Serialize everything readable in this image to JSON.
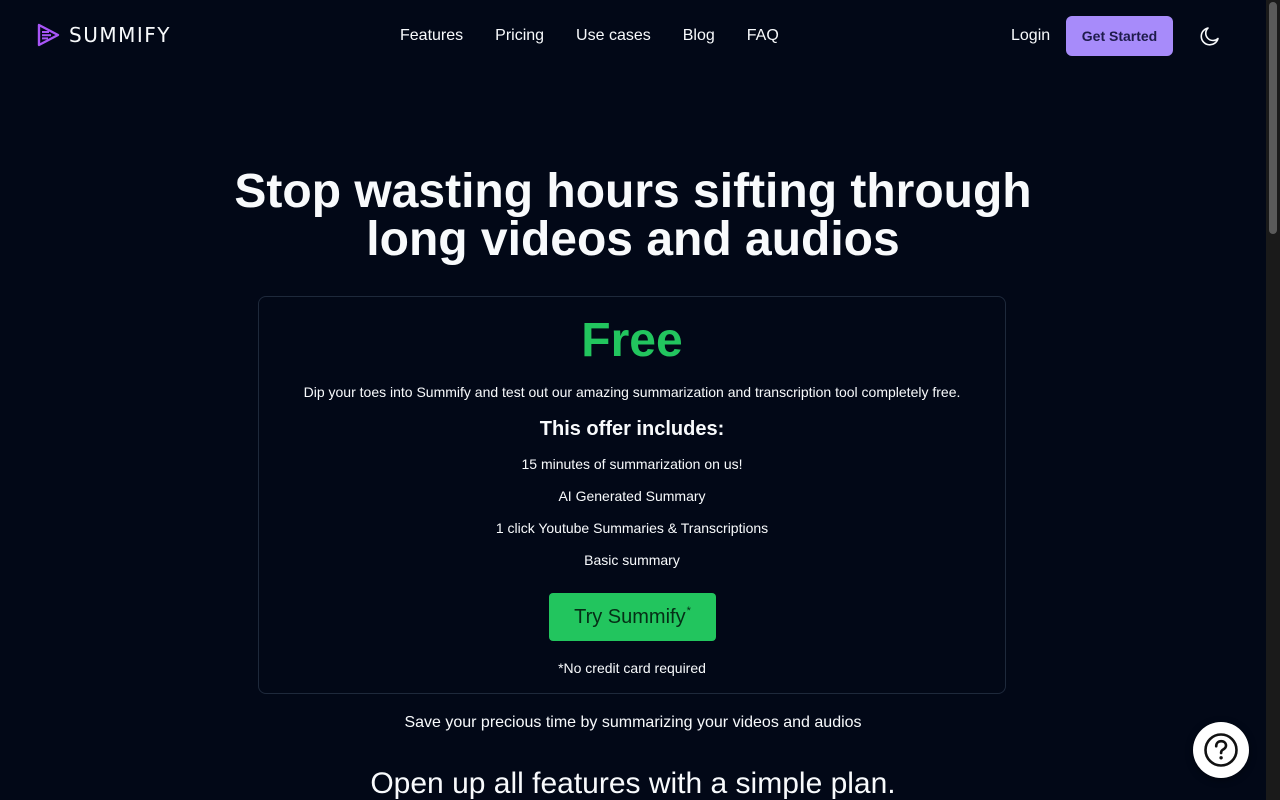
{
  "header": {
    "logo_text": "SUMMIFY",
    "nav": [
      "Features",
      "Pricing",
      "Use cases",
      "Blog",
      "FAQ"
    ],
    "login_label": "Login",
    "get_started_label": "Get Started",
    "theme_toggle_icon": "moon-icon"
  },
  "hero": {
    "title_line1": "Stop wasting hours sifting through",
    "title_line2": "long videos and audios"
  },
  "offer_card": {
    "title": "Free",
    "description": "Dip your toes into Summify and test out our amazing summarization and transcription tool completely free.",
    "includes_heading": "This offer includes:",
    "features": [
      "15 minutes of summarization on us!",
      "AI Generated Summary",
      "1 click Youtube Summaries & Transcriptions",
      "Basic summary"
    ],
    "cta_label": "Try Summify",
    "cta_mark": "*",
    "note": "*No credit card required"
  },
  "tagline": "Save your precious time by summarizing your videos and audios",
  "plan_heading": "Open up all features with a simple plan.",
  "help_icon": "question-circle-icon",
  "colors": {
    "background": "#020817",
    "accent_purple": "#a78bfa",
    "accent_green": "#22c55e",
    "card_border": "#1e293b"
  }
}
